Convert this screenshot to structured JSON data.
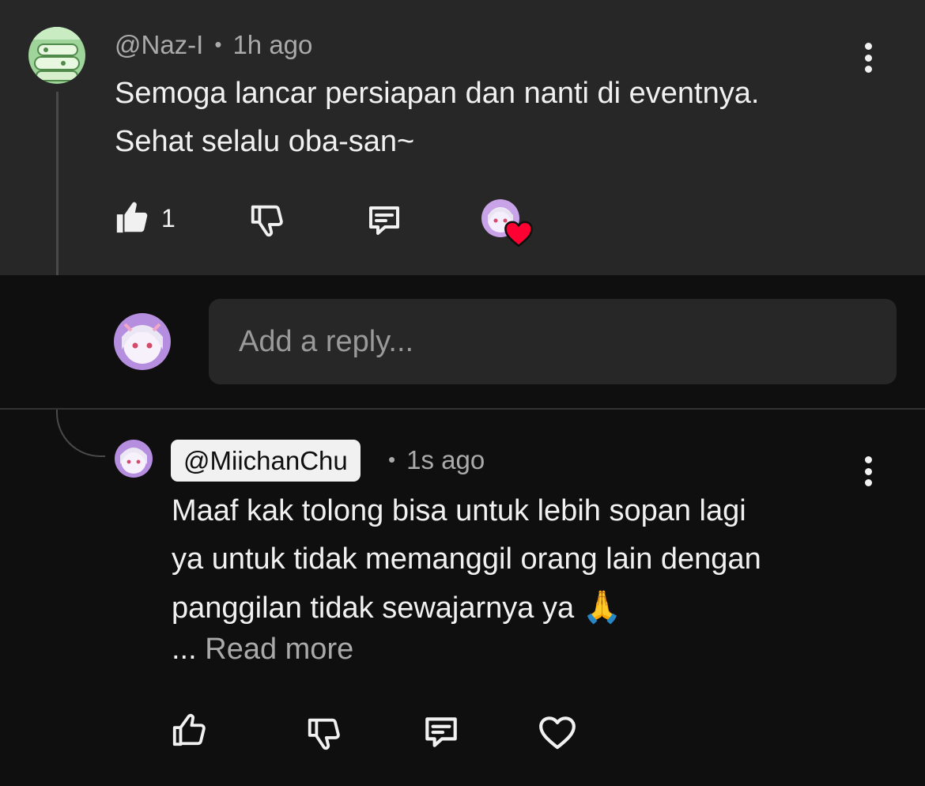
{
  "parent_comment": {
    "handle": "@Naz-I",
    "separator": "•",
    "time": "1h ago",
    "text_line1": "Semoga lancar persiapan dan nanti di eventnya.",
    "text_line2": "Sehat selalu oba-san~",
    "like_count": "1",
    "creator_heart": true
  },
  "reply_box": {
    "placeholder": "Add a reply..."
  },
  "reply_comment": {
    "handle": "@MiichanChu",
    "separator": "•",
    "time": "1s ago",
    "text_line1": "Maaf kak tolong bisa untuk lebih sopan lagi",
    "text_line2": "ya untuk tidak memanggil orang lain dengan",
    "text_line3": "panggilan tidak sewajarnya ya",
    "emoji": "🙏",
    "read_more_ellipsis": "...",
    "read_more_label": "Read more"
  },
  "icons": {
    "like": "thumb-up-icon",
    "dislike": "thumb-down-icon",
    "reply": "comment-icon",
    "heart": "heart-icon",
    "more": "more-vertical-icon"
  },
  "colors": {
    "background": "#0f0f0f",
    "card_background": "#272727",
    "text_primary": "#f1f1f1",
    "text_secondary": "#aaaaaa",
    "heart_red": "#ff0033"
  }
}
